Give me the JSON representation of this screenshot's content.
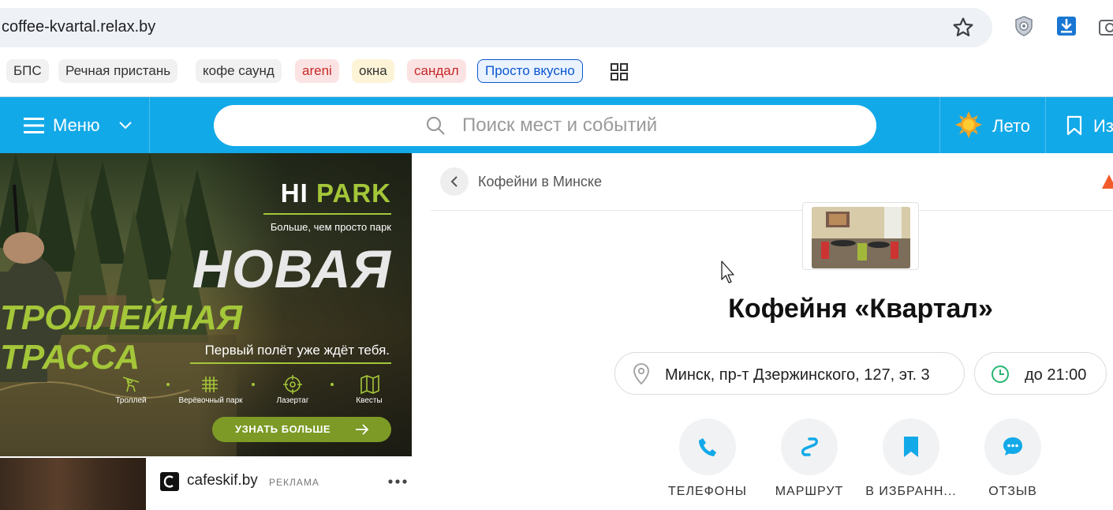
{
  "browser": {
    "url": "coffee-kvartal.relax.by",
    "bookmarks": [
      {
        "label": "БПС",
        "style": "gray"
      },
      {
        "label": "Речная пристань",
        "style": "gray"
      },
      {
        "label": "кофе саунд",
        "style": "gray"
      },
      {
        "label": "areni",
        "style": "red"
      },
      {
        "label": "окна",
        "style": "yellow"
      },
      {
        "label": "сандал",
        "style": "red"
      },
      {
        "label": "Просто вкусно",
        "style": "blue"
      }
    ]
  },
  "header": {
    "menu_label": "Меню",
    "search_placeholder": "Поиск мест и событий",
    "season_label": "Лето",
    "favorites_label": "Из",
    "colors": {
      "bar": "#12a9e8",
      "accent_orange": "#f5a623"
    }
  },
  "ad": {
    "brand_hi": "HI",
    "brand_park": "PARK",
    "subtitle": "Больше, чем просто парк",
    "headline1": "НОВАЯ",
    "headline2": "ТРОЛЛЕЙНАЯ ТРАССА",
    "tagline": "Первый полёт уже ждёт тебя.",
    "features": [
      "Троллей",
      "Верёвочный парк",
      "Лазертаг",
      "Квесты"
    ],
    "cta": "УЗНАТЬ БОЛЬШЕ",
    "colors": {
      "green": "#a4c639"
    }
  },
  "ad_card": {
    "site": "cafeskif.by",
    "label": "РЕКЛАМА"
  },
  "place": {
    "breadcrumb": "Кофейни в Минске",
    "title": "Кофейня «Квартал»",
    "address": "Минск, пр-т Дзержинского, 127, эт. 3",
    "hours": "до 21:00",
    "actions": [
      {
        "label": "ТЕЛЕФОНЫ",
        "icon": "phone-icon"
      },
      {
        "label": "МАРШРУТ",
        "icon": "route-icon"
      },
      {
        "label": "В ИЗБРАНН...",
        "icon": "bookmark-icon"
      },
      {
        "label": "ОТЗЫВ",
        "icon": "comment-icon"
      }
    ],
    "colors": {
      "icon_blue": "#12a9e8",
      "clock_green": "#2bb673"
    }
  }
}
